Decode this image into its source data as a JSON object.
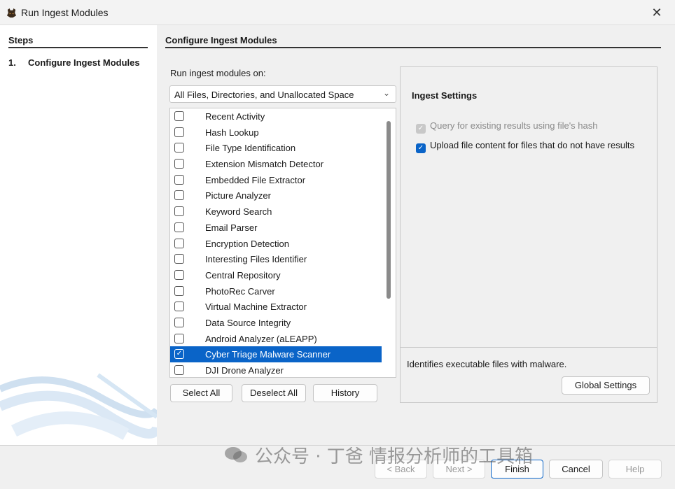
{
  "window": {
    "title": "Run Ingest Modules"
  },
  "steps": {
    "header": "Steps",
    "items": [
      {
        "number": "1.",
        "label": "Configure Ingest Modules"
      }
    ]
  },
  "main": {
    "header": "Configure Ingest Modules",
    "run_on_label": "Run ingest modules on:",
    "run_on_value": "All Files, Directories, and Unallocated Space",
    "modules": [
      {
        "label": "Recent Activity",
        "checked": false,
        "selected": false
      },
      {
        "label": "Hash Lookup",
        "checked": false,
        "selected": false
      },
      {
        "label": "File Type Identification",
        "checked": false,
        "selected": false
      },
      {
        "label": "Extension Mismatch Detector",
        "checked": false,
        "selected": false
      },
      {
        "label": "Embedded File Extractor",
        "checked": false,
        "selected": false
      },
      {
        "label": "Picture Analyzer",
        "checked": false,
        "selected": false
      },
      {
        "label": "Keyword Search",
        "checked": false,
        "selected": false
      },
      {
        "label": "Email Parser",
        "checked": false,
        "selected": false
      },
      {
        "label": "Encryption Detection",
        "checked": false,
        "selected": false
      },
      {
        "label": "Interesting Files Identifier",
        "checked": false,
        "selected": false
      },
      {
        "label": "Central Repository",
        "checked": false,
        "selected": false
      },
      {
        "label": "PhotoRec Carver",
        "checked": false,
        "selected": false
      },
      {
        "label": "Virtual Machine Extractor",
        "checked": false,
        "selected": false
      },
      {
        "label": "Data Source Integrity",
        "checked": false,
        "selected": false
      },
      {
        "label": "Android Analyzer (aLEAPP)",
        "checked": false,
        "selected": false
      },
      {
        "label": "Cyber Triage Malware Scanner",
        "checked": true,
        "selected": true
      },
      {
        "label": "DJI Drone Analyzer",
        "checked": false,
        "selected": false
      }
    ],
    "select_all_label": "Select All",
    "deselect_all_label": "Deselect All",
    "history_label": "History"
  },
  "settings": {
    "title": "Ingest Settings",
    "options": [
      {
        "label": "Query for existing results using file's hash",
        "checked": true,
        "enabled": false
      },
      {
        "label": "Upload file content for files that do not have results",
        "checked": true,
        "enabled": true
      }
    ],
    "description": "Identifies executable files with malware.",
    "global_settings_label": "Global Settings"
  },
  "footer": {
    "back_label": "< Back",
    "next_label": "Next >",
    "finish_label": "Finish",
    "cancel_label": "Cancel",
    "help_label": "Help"
  },
  "watermark": {
    "text": "公众号 · 丁爸 情报分析师的工具箱"
  },
  "colors": {
    "accent": "#0a64c8",
    "panel": "#f0f0f0"
  }
}
